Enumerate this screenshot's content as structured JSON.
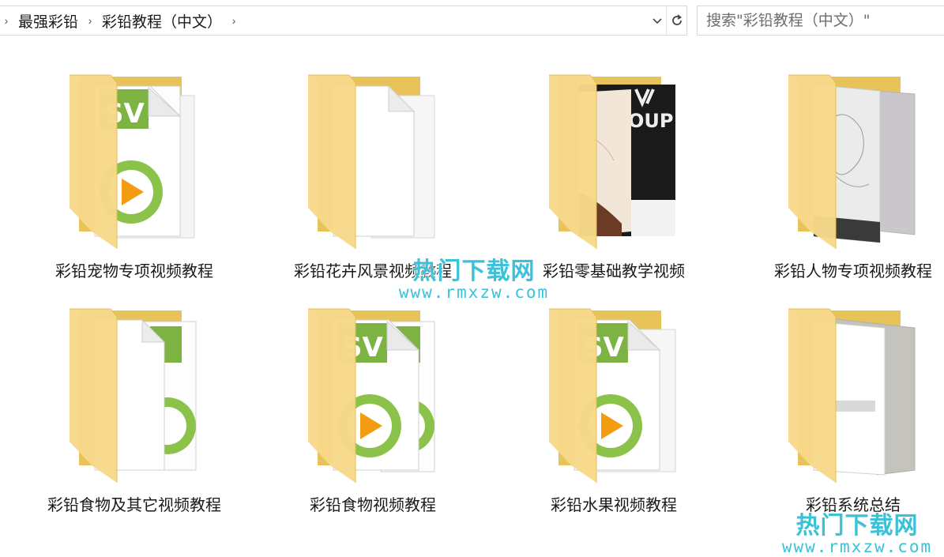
{
  "address_bar": {
    "breadcrumbs": [
      "最强彩铅",
      "彩铅教程（中文）"
    ]
  },
  "search": {
    "placeholder": "搜索\"彩铅教程（中文）\""
  },
  "folders": [
    {
      "name": "彩铅宠物专项视频教程",
      "thumbnail": "video-file"
    },
    {
      "name": "彩铅花卉风景视频教程",
      "thumbnail": "blank-document"
    },
    {
      "name": "彩铅零基础教学视频",
      "thumbnail": "photo"
    },
    {
      "name": "彩铅人物专项视频教程",
      "thumbnail": "sketch-photo"
    },
    {
      "name": "彩铅食物及其它视频教程",
      "thumbnail": "video-file"
    },
    {
      "name": "彩铅食物视频教程",
      "thumbnail": "video-file"
    },
    {
      "name": "彩铅水果视频教程",
      "thumbnail": "video-file"
    },
    {
      "name": "彩铅系统总结",
      "thumbnail": "blurred-document"
    }
  ],
  "watermark": {
    "brand": "热门下载网",
    "url": "www.rmxzw.com"
  },
  "colors": {
    "folder_back": "#e8c35a",
    "folder_front": "#f7d98a",
    "video_green": "#7cb342",
    "play_orange": "#f39c12",
    "watermark": "#3cc2d8"
  }
}
